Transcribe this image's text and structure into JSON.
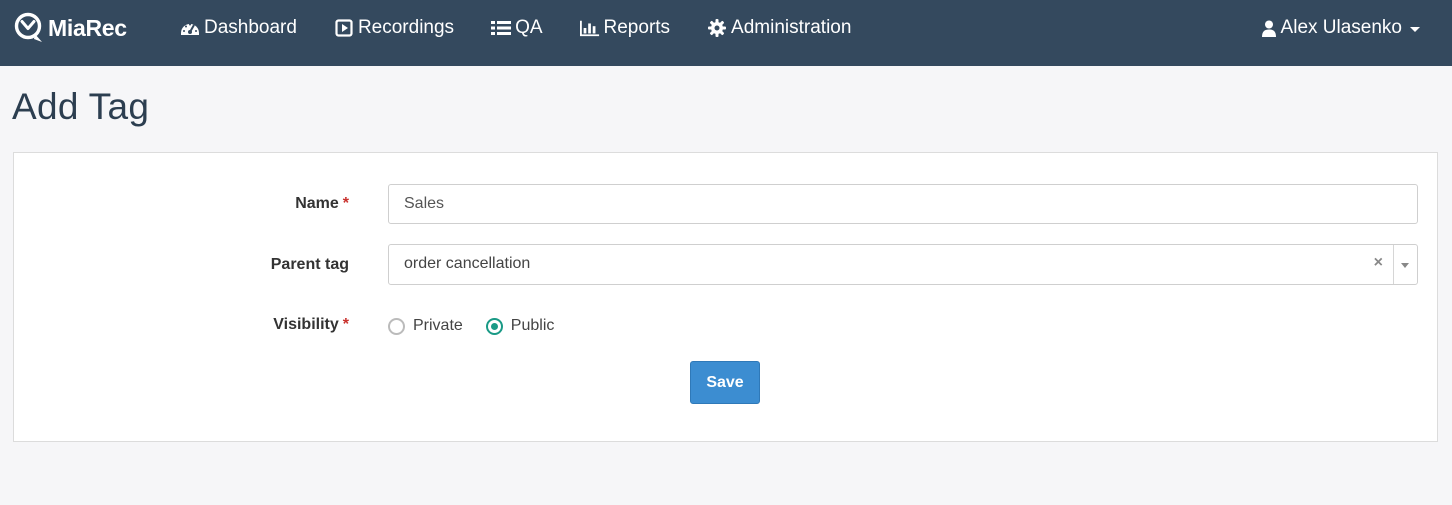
{
  "app": {
    "brand": "MiaRec"
  },
  "nav": {
    "items": [
      {
        "label": "Dashboard",
        "icon": "dashboard-icon"
      },
      {
        "label": "Recordings",
        "icon": "play-square-icon"
      },
      {
        "label": "QA",
        "icon": "list-icon"
      },
      {
        "label": "Reports",
        "icon": "bar-chart-icon"
      },
      {
        "label": "Administration",
        "icon": "gear-icon"
      }
    ],
    "user": {
      "name": "Alex Ulasenko",
      "icon": "user-icon"
    }
  },
  "page": {
    "title": "Add Tag"
  },
  "form": {
    "name": {
      "label": "Name",
      "required_mark": "*",
      "value": "Sales"
    },
    "parent_tag": {
      "label": "Parent tag",
      "selected": "order cancellation",
      "clear_glyph": "×"
    },
    "visibility": {
      "label": "Visibility",
      "required_mark": "*",
      "options": [
        {
          "label": "Private",
          "checked": false
        },
        {
          "label": "Public",
          "checked": true
        }
      ]
    },
    "save_label": "Save"
  },
  "colors": {
    "navbar": "#34495e",
    "page_bg": "#f6f6f8",
    "title": "#2c3e50",
    "primary": "#3c8dd1",
    "radio_checked": "#1a9a86",
    "required": "#c9302c"
  }
}
